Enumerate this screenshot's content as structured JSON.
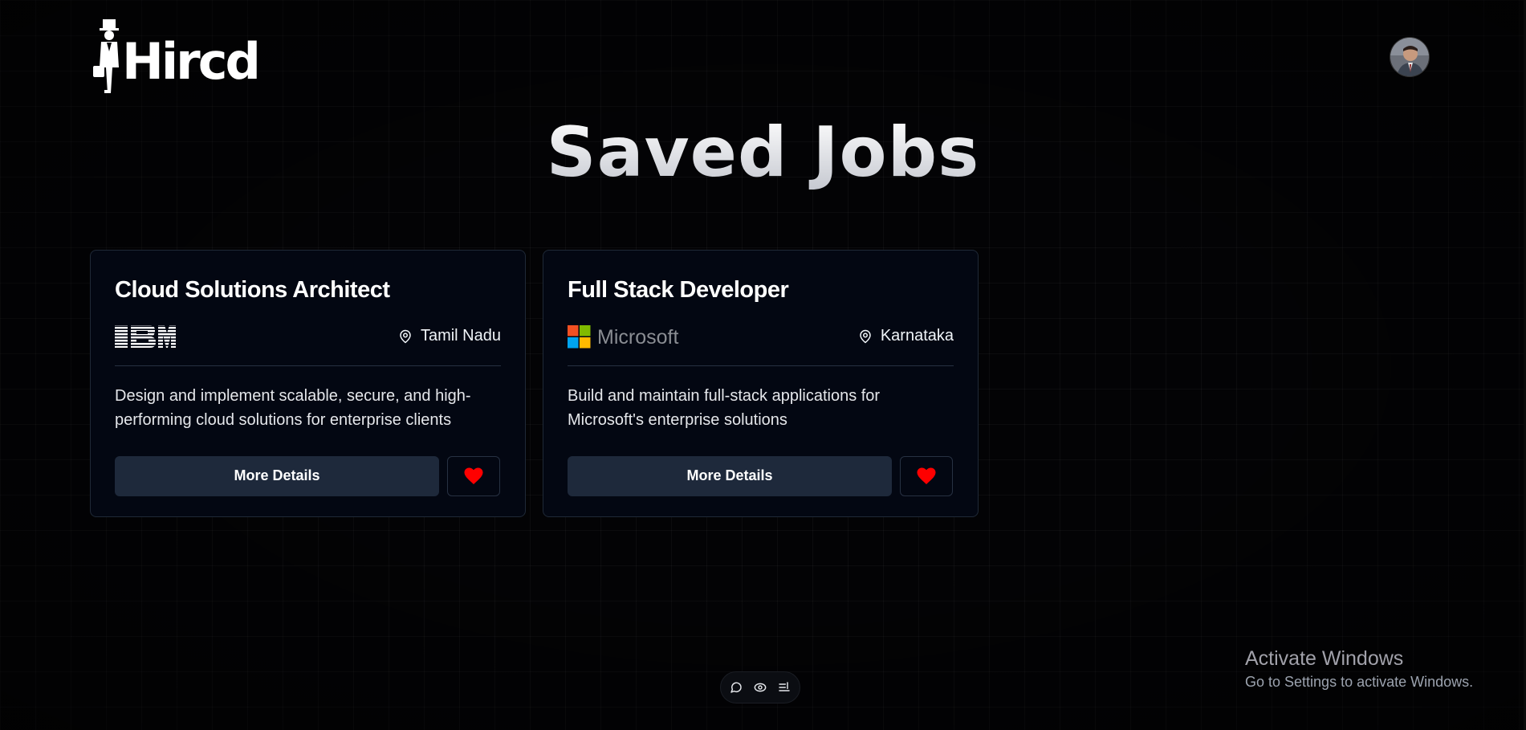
{
  "header": {
    "logo_text": "Hircd",
    "avatar_alt": "User profile"
  },
  "page": {
    "title": "Saved Jobs"
  },
  "jobs": [
    {
      "title": "Cloud Solutions Architect",
      "company": "IBM",
      "location": "Tamil Nadu",
      "description": "Design and implement scalable, secure, and high-performing cloud solutions for enterprise clients",
      "details_label": "More Details",
      "saved": true
    },
    {
      "title": "Full Stack Developer",
      "company": "Microsoft",
      "location": "Karnataka",
      "description": "Build and maintain full-stack applications for Microsoft's enterprise solutions",
      "details_label": "More Details",
      "saved": true
    }
  ],
  "toolbar": {
    "icons": [
      "chat-icon",
      "eye-icon",
      "list-icon"
    ]
  },
  "watermark": {
    "title": "Activate Windows",
    "subtitle": "Go to Settings to activate Windows."
  },
  "colors": {
    "background": "#030305",
    "card": "#030712",
    "button": "#1e293b",
    "heart": "#ff0000"
  }
}
